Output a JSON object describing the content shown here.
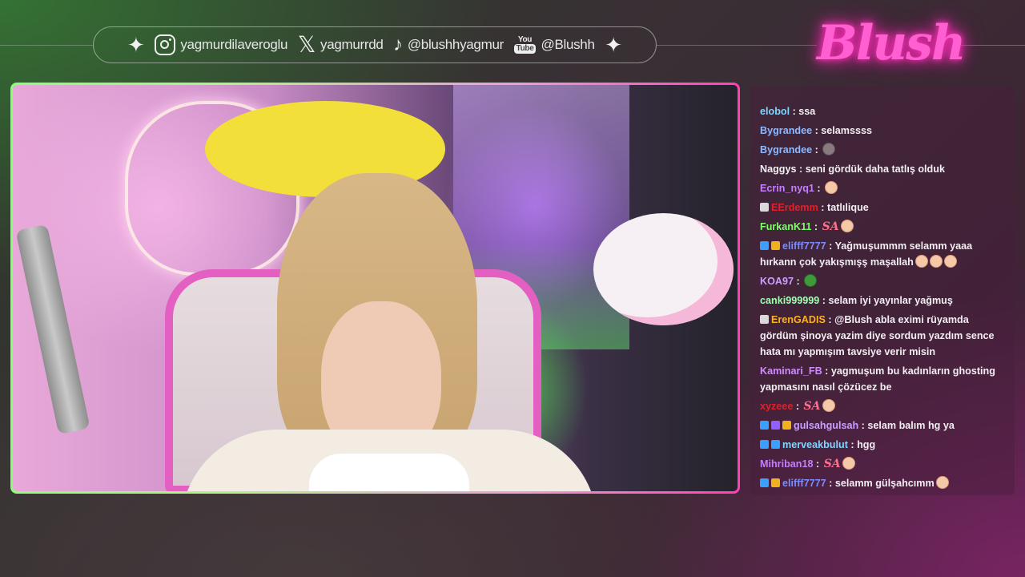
{
  "social_bar": {
    "items": [
      {
        "icon": "instagram-icon",
        "label": "yagmurdilaveroglu"
      },
      {
        "icon": "x-icon",
        "label": "yagmurrdd"
      },
      {
        "icon": "tiktok-icon",
        "label": "@blushhyagmur"
      },
      {
        "icon": "youtube-icon",
        "label": "@Blushh"
      }
    ],
    "youtube_icon_text_top": "You",
    "youtube_icon_text_bottom": "Tube",
    "sparkle": "✦"
  },
  "logo": {
    "text": "Blush",
    "color": "#ff5fd0"
  },
  "theme": {
    "accent_green": "#8cff7a",
    "accent_pink": "#ff3fb5"
  },
  "chat": {
    "messages": [
      {
        "user": "elobol",
        "color": "#7fd6ff",
        "text": "ssa"
      },
      {
        "user": "Bygrandee",
        "color": "#8fb8ff",
        "text": "selamssss"
      },
      {
        "user": "Bygrandee",
        "color": "#8fb8ff",
        "text": "",
        "emote": "cat-emote"
      },
      {
        "user": "Naggys",
        "color": "#f3eef3",
        "text": "seni gördük daha tatlış olduk"
      },
      {
        "user": "Ecrin_nyq1",
        "color": "#c77dff",
        "text": "",
        "emote": "girl-emote"
      },
      {
        "user": "EErdemm",
        "color": "#e0202a",
        "text": "tatlılique",
        "badges": [
          "#d9d9d9"
        ]
      },
      {
        "user": "FurkanK11",
        "color": "#7dff6a",
        "text": "",
        "sa": "SA",
        "emote": "girl-emote"
      },
      {
        "user": "elifff7777",
        "color": "#7a8cff",
        "text": "Yağmuşummm selamm yaaa hırkann çok yakışmışş maşallah",
        "badges": [
          "#3aa0ff",
          "#f0b020"
        ],
        "emotes": [
          "girl-emote",
          "girl-emote",
          "girl-emote"
        ]
      },
      {
        "user": "KOA97",
        "color": "#c9a0ff",
        "text": "",
        "emote": "frog-emote"
      },
      {
        "user": "canki999999",
        "color": "#9fffb0",
        "text": "selam iyi yayınlar yağmuş"
      },
      {
        "user": "ErenGADIS",
        "color": "#ffb020",
        "text": "@Blush abla eximi rüyamda gördüm şinoya yazim diye sordum yazdım sence hata mı yapmışım tavsiye verir misin",
        "badges": [
          "#d9d9d9"
        ]
      },
      {
        "user": "Kaminari_FB",
        "color": "#d08cff",
        "text": "yagmuşum bu kadınların ghosting yapmasını nasıl çözücez be"
      },
      {
        "user": "xyzeee",
        "color": "#e0202a",
        "text": "",
        "sa": "SA",
        "emote": "girl-emote"
      },
      {
        "user": "gulsahgulsah",
        "color": "#c9a0ff",
        "text": "selam balım hg ya",
        "badges": [
          "#3aa0ff",
          "#9060ff",
          "#f0b020"
        ]
      },
      {
        "user": "merveakbulut",
        "color": "#7fd6ff",
        "text": "hgg",
        "badges": [
          "#3aa0ff",
          "#3aa0ff"
        ]
      },
      {
        "user": "Mihriban18",
        "color": "#c77dff",
        "text": "",
        "sa": "SA",
        "emote": "girl-emote"
      },
      {
        "user": "elifff7777",
        "color": "#7a8cff",
        "text": "selamm gülşahcımm",
        "badges": [
          "#3aa0ff",
          "#f0b020"
        ],
        "emote": "girl-emote"
      }
    ]
  }
}
